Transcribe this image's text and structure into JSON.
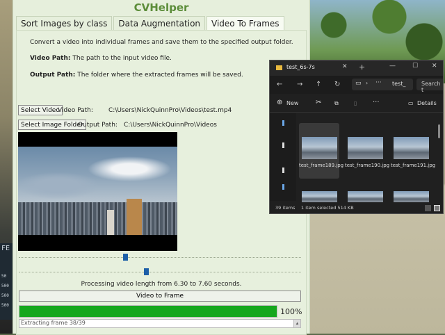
{
  "app": {
    "title": "CVHelper",
    "tabs": [
      "Sort Images by class",
      "Data Augmentation",
      "Video To Frames"
    ],
    "active_tab": "Video To Frames",
    "description": "Convert a video into individual frames and save them to the specified output folder.",
    "video_path_heading": "Video Path:",
    "video_path_help": "The path to the input video file.",
    "output_path_heading": "Output Path:",
    "output_path_help": "The folder where the extracted frames will be saved.",
    "select_video_label": "Select Video",
    "video_path_label": "Video Path:",
    "video_path_value": "C:\\Users\\NickQuinnPro\\Videos\\test.mp4",
    "select_folder_label": "Select Image Folder",
    "output_path_label": "Output Path:",
    "output_path_value": "C:\\Users\\NickQuinnPro\\Videos",
    "status_text": "Processing video length from 6.30 to 7.60 seconds.",
    "convert_button_label": "Video to Frame",
    "progress_percent": 100,
    "progress_text": "100%",
    "log_text": "Extracting frame 38/39"
  },
  "explorer": {
    "tab_title": "test_6s-7s",
    "address_text": "test_",
    "search_text": "Search t",
    "new_label": "New",
    "details_label": "Details",
    "files": [
      {
        "name": "test_frame189.jpg"
      },
      {
        "name": "test_frame190.jpg"
      },
      {
        "name": "test_frame191.jpg"
      }
    ],
    "item_count": "39 items",
    "selection_info": "1 item selected  514 KB"
  },
  "background": {
    "side_text": [
      "FE",
      "50",
      "500",
      "500",
      "500"
    ]
  },
  "colors": {
    "accent_green": "#5c8d3a",
    "progress_fill": "#15a71c",
    "slider_thumb": "#1d5fa8"
  }
}
